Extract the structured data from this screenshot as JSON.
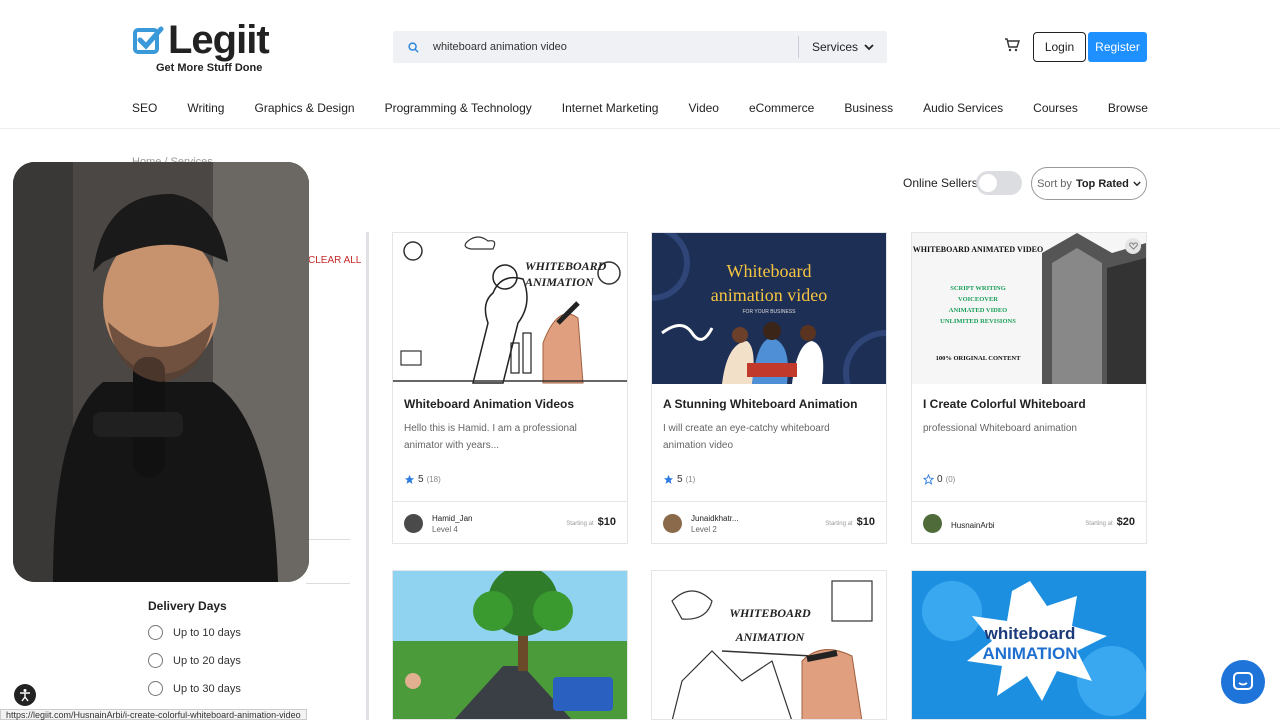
{
  "header": {
    "logo_text": "Legiit",
    "logo_tagline": "Get More Stuff Done",
    "search_value": "whiteboard animation video",
    "search_category": "Services",
    "login_label": "Login",
    "register_label": "Register"
  },
  "nav": {
    "items": [
      "SEO",
      "Writing",
      "Graphics & Design",
      "Programming & Technology",
      "Internet Marketing",
      "Video",
      "eCommerce",
      "Business",
      "Audio Services",
      "Courses",
      "Browse"
    ]
  },
  "breadcrumb": "Home  /  Services",
  "filters": {
    "online_label": "Online Sellers",
    "sort_prefix": "Sort by",
    "sort_value": "Top Rated",
    "clear_all": "CLEAR ALL",
    "delivery_title": "Delivery Days",
    "delivery_options": [
      "Up to 10 days",
      "Up to 20 days",
      "Up to 30 days"
    ]
  },
  "cards": [
    {
      "title": "Whiteboard Animation Videos",
      "desc": "Hello this is Hamid. I am a professional animator with years...",
      "rating": "5",
      "count": "(18)",
      "seller": "Hamid_Jan",
      "level": "Level 4",
      "price_label": "Starting at",
      "price": "$10",
      "img_text": [
        "WHITEBOARD",
        "ANIMATION"
      ]
    },
    {
      "title": "A Stunning Whiteboard Animation",
      "desc": "I will create an eye-catchy whiteboard animation video",
      "rating": "5",
      "count": "(1)",
      "seller": "Junaidkhatr...",
      "level": "Level 2",
      "price_label": "Starting at",
      "price": "$10",
      "img_text": [
        "Whiteboard",
        "animation video",
        "FOR YOUR BUSINESS"
      ]
    },
    {
      "title": "I Create Colorful Whiteboard",
      "desc": "professional Whiteboard animation",
      "rating": "0",
      "count": "(0)",
      "seller": "HusnainArbi",
      "level": "",
      "price_label": "Starting at",
      "price": "$20",
      "img_text": [
        "WHITEBOARD ANIMATED VIDEO",
        "SCRIPT WRITING",
        "VOICEOVER",
        "ANIMATED VIDEO",
        "UNLIMITED REVISIONS",
        "100% ORIGINAL CONTENT"
      ]
    }
  ],
  "cards_bottom": [
    {
      "img_text": []
    },
    {
      "img_text": [
        "WHITEBOARD",
        "ANIMATION"
      ]
    },
    {
      "img_text": [
        "whiteboard",
        "ANIMATION"
      ]
    }
  ],
  "status_url": "https://legiit.com/HusnainArbi/i-create-colorful-whiteboard-animation-video",
  "colors": {
    "accent": "#1e90ff",
    "star": "#2f7de1",
    "clear": "#c62828"
  }
}
